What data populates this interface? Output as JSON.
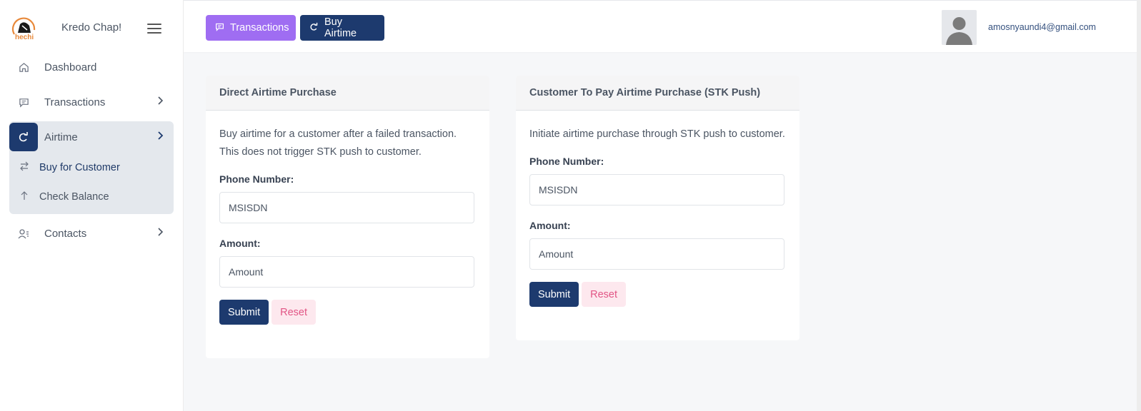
{
  "app": {
    "brand_name": "Kredo Chap!",
    "logo_text": "hechi"
  },
  "sidebar": {
    "items": [
      {
        "label": "Dashboard",
        "icon": "home-icon"
      },
      {
        "label": "Transactions",
        "icon": "message-icon"
      },
      {
        "label": "Airtime",
        "icon": "redo-icon",
        "active": true,
        "children": [
          {
            "label": "Buy for Customer",
            "icon": "swap-icon"
          },
          {
            "label": "Check Balance",
            "icon": "arrow-up-icon"
          }
        ]
      },
      {
        "label": "Contacts",
        "icon": "user-list-icon"
      }
    ]
  },
  "topbar": {
    "buttons": [
      {
        "label": "Transactions",
        "icon": "message-icon",
        "color": "#9f6df2"
      },
      {
        "label": "Buy Airtime",
        "icon": "redo-icon",
        "color": "#1d3a6e"
      }
    ],
    "user_email": "amosnyaundi4@gmail.com"
  },
  "cards": [
    {
      "title": "Direct Airtime Purchase",
      "description": "Buy airtime for a customer after a failed transaction. This does not trigger STK push to customer.",
      "phone_label": "Phone Number:",
      "phone_placeholder": "MSISDN",
      "amount_label": "Amount:",
      "amount_placeholder": "Amount",
      "submit_label": "Submit",
      "reset_label": "Reset"
    },
    {
      "title": "Customer To Pay Airtime Purchase (STK Push)",
      "description": "Initiate airtime purchase through STK push to customer.",
      "phone_label": "Phone Number:",
      "phone_placeholder": "MSISDN",
      "amount_label": "Amount:",
      "amount_placeholder": "Amount",
      "submit_label": "Submit",
      "reset_label": "Reset"
    }
  ],
  "colors": {
    "primary": "#1d3a6e",
    "accent": "#9f6df2",
    "reset_bg": "#fde8ee",
    "reset_text": "#e25585"
  }
}
